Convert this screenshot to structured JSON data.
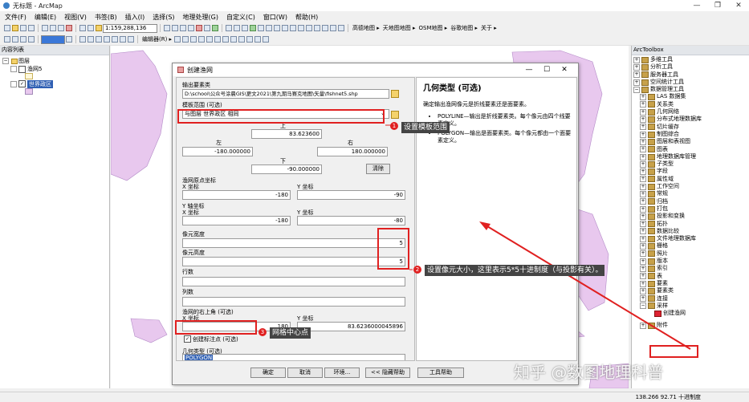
{
  "window": {
    "title": "无标题 - ArcMap"
  },
  "menu": [
    "文件(F)",
    "编辑(E)",
    "视图(V)",
    "书签(B)",
    "插入(I)",
    "选择(S)",
    "地理处理(G)",
    "自定义(C)",
    "窗口(W)",
    "帮助(H)"
  ],
  "toolbar": {
    "scale": "1:159,288,136",
    "basemaps": [
      "高德地图 ▸",
      "天地图地图 ▸",
      "OSM地图 ▸",
      "谷歌地图 ▸",
      "关于 ▸"
    ],
    "editor_label": "编辑器(R) ▸"
  },
  "toc": {
    "title": "内容列表",
    "layers_label": "图层",
    "layer1": "渔网5",
    "layer2": "世界政区"
  },
  "arctoolbox": {
    "title": "ArcToolbox",
    "items": [
      {
        "label": "多维工具",
        "indent": 0,
        "exp": "+"
      },
      {
        "label": "分析工具",
        "indent": 0,
        "exp": "+"
      },
      {
        "label": "服务器工具",
        "indent": 0,
        "exp": "+"
      },
      {
        "label": "空间统计工具",
        "indent": 0,
        "exp": "+"
      },
      {
        "label": "数据管理工具",
        "indent": 0,
        "exp": "−"
      },
      {
        "label": "LAS 数据集",
        "indent": 1,
        "exp": "+"
      },
      {
        "label": "关系类",
        "indent": 1,
        "exp": "+"
      },
      {
        "label": "几何网络",
        "indent": 1,
        "exp": "+"
      },
      {
        "label": "分布式地理数据库",
        "indent": 1,
        "exp": "+"
      },
      {
        "label": "切片缓存",
        "indent": 1,
        "exp": "+"
      },
      {
        "label": "制图综合",
        "indent": 1,
        "exp": "+"
      },
      {
        "label": "图层和表视图",
        "indent": 1,
        "exp": "+"
      },
      {
        "label": "图表",
        "indent": 1,
        "exp": "+"
      },
      {
        "label": "地理数据库管理",
        "indent": 1,
        "exp": "+"
      },
      {
        "label": "子类型",
        "indent": 1,
        "exp": "+"
      },
      {
        "label": "字段",
        "indent": 1,
        "exp": "+"
      },
      {
        "label": "属性域",
        "indent": 1,
        "exp": "+"
      },
      {
        "label": "工作空间",
        "indent": 1,
        "exp": "+"
      },
      {
        "label": "常规",
        "indent": 1,
        "exp": "+"
      },
      {
        "label": "归档",
        "indent": 1,
        "exp": "+"
      },
      {
        "label": "打包",
        "indent": 1,
        "exp": "+"
      },
      {
        "label": "投影和变换",
        "indent": 1,
        "exp": "+"
      },
      {
        "label": "拓扑",
        "indent": 1,
        "exp": "+"
      },
      {
        "label": "数据比较",
        "indent": 1,
        "exp": "+"
      },
      {
        "label": "文件地理数据库",
        "indent": 1,
        "exp": "+"
      },
      {
        "label": "栅格",
        "indent": 1,
        "exp": "+"
      },
      {
        "label": "照片",
        "indent": 1,
        "exp": "+"
      },
      {
        "label": "版本",
        "indent": 1,
        "exp": "+"
      },
      {
        "label": "索引",
        "indent": 1,
        "exp": "+"
      },
      {
        "label": "表",
        "indent": 1,
        "exp": "+"
      },
      {
        "label": "要素",
        "indent": 1,
        "exp": "+"
      },
      {
        "label": "要素类",
        "indent": 1,
        "exp": "+"
      },
      {
        "label": "连接",
        "indent": 1,
        "exp": "+"
      },
      {
        "label": "采样",
        "indent": 1,
        "exp": "−"
      },
      {
        "label": "创建渔网",
        "indent": 2,
        "exp": ""
      }
    ],
    "last_item": "附件"
  },
  "status": {
    "coords": "138.266  92.71 十进制度"
  },
  "dialog": {
    "title": "创建渔网",
    "output_label": "输出要素类",
    "output_value": "D:\\school\\公众号涂晨GIS\\更文2021\\第九期马赛克地图\\矢量\\fishnet5.shp",
    "template_label": "模板范围 (可选)",
    "template_value": "与图层 世界政区 相同",
    "top_label": "上",
    "top_value": "83.623600",
    "left_label": "左",
    "left_value": "-180.000000",
    "right_label": "右",
    "right_value": "180.000000",
    "bottom_label": "下",
    "bottom_value": "-90.000000",
    "clear_label": "清除",
    "origin_label": "渔网原点坐标",
    "x_coord_label": "X 坐标",
    "y_coord_label": "Y 坐标",
    "origin_x": "-180",
    "origin_y": "-90",
    "yaxis_label": "Y 轴坐标",
    "yaxis_x": "-180",
    "yaxis_y": "-80",
    "cell_width_label": "像元宽度",
    "cell_width": "5",
    "cell_height_label": "像元高度",
    "cell_height": "5",
    "rows_label": "行数",
    "cols_label": "列数",
    "corner_label": "渔网的右上角 (可选)",
    "corner_x": "180",
    "corner_y": "83.6236000045896",
    "label_points": "创建标注点 (可选)",
    "geom_label": "几何类型 (可选)",
    "geom_value": "POLYGON",
    "buttons": {
      "ok": "确定",
      "cancel": "取消",
      "env": "环境...",
      "hide_help": "<< 隐藏帮助",
      "tool_help": "工具帮助"
    }
  },
  "help": {
    "title": "几何类型 (可选)",
    "desc": "确定输出渔网像元是折线要素还是面要素。",
    "bullets": [
      "POLYLINE—输出是折线要素类。每个像元由四个线要素定义。",
      "POLYGON—输出是面要素类。每个像元都由一个面要素定义。"
    ]
  },
  "annotations": {
    "a1": "设置模板范围",
    "a2": "设置像元大小，这里表示5*5十进制度（与投影有关）。",
    "a3": "网格中心点",
    "n1": "1",
    "n2": "2",
    "n3": "3"
  },
  "watermark": "知乎 @数图地理科普",
  "colors": {
    "annotation_red": "#e02020",
    "callout_bg": "#444444",
    "polygon_fill": "#e8c8ee"
  }
}
